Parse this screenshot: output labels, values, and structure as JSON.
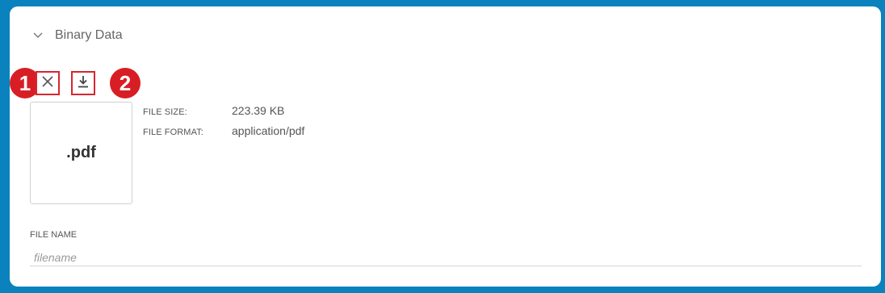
{
  "section": {
    "title": "Binary Data",
    "expanded": true
  },
  "icons": {
    "expand": "chevron-down-icon",
    "remove": "close-icon",
    "download": "download-icon"
  },
  "callouts": [
    "1",
    "2"
  ],
  "file": {
    "thumbnail_label": ".pdf",
    "size_label": "FILE SIZE:",
    "size_value": "223.39 KB",
    "format_label": "FILE FORMAT:",
    "format_value": "application/pdf"
  },
  "name_field": {
    "label": "FILE NAME",
    "placeholder": "filename",
    "value": ""
  },
  "colors": {
    "frame": "#0a82bd",
    "callout": "#d81e25",
    "highlight_border": "#d8262f"
  }
}
